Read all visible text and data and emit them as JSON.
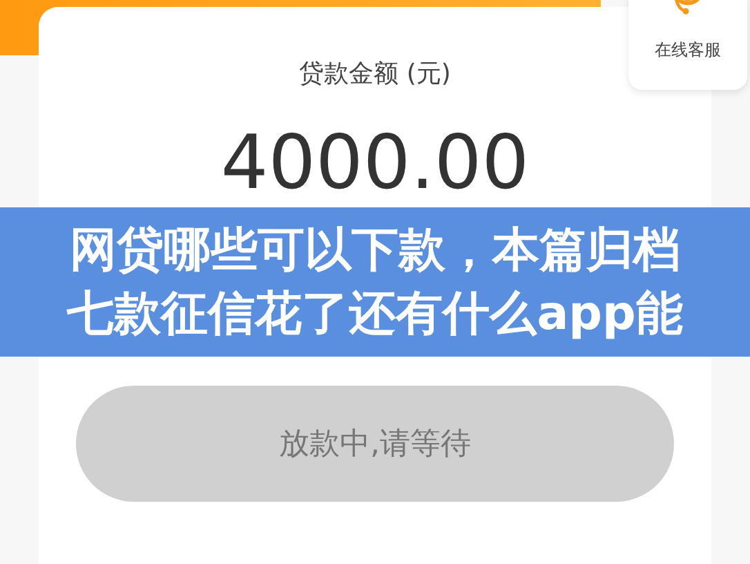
{
  "service_widget": {
    "label": "在线客服"
  },
  "loan_card": {
    "amount_label": "贷款金额 (元)",
    "amount": "4000.00"
  },
  "banner": {
    "lines": [
      "网贷哪些可以下款，本篇归档",
      "七款征信花了还有什么app能"
    ]
  },
  "status_button": {
    "label": "放款中,请等待",
    "disabled": true
  }
}
